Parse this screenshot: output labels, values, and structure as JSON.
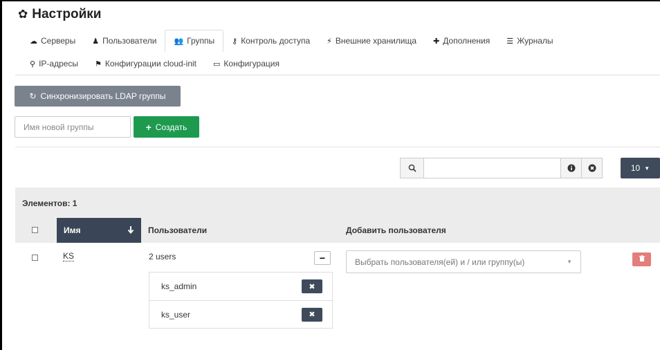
{
  "page": {
    "title": "Настройки",
    "title_icon": "gear-icon"
  },
  "tabs_row1": [
    {
      "label": "Серверы",
      "icon": "cloud-icon",
      "glyph": "☁"
    },
    {
      "label": "Пользователи",
      "icon": "user-icon",
      "glyph": "♟"
    },
    {
      "label": "Группы",
      "icon": "users-icon",
      "glyph": "👥",
      "active": true
    },
    {
      "label": "Контроль доступа",
      "icon": "key-icon",
      "glyph": "⚷"
    },
    {
      "label": "Внешние хранилища",
      "icon": "plug-icon",
      "glyph": "⚡"
    },
    {
      "label": "Дополнения",
      "icon": "puzzle-icon",
      "glyph": "✚"
    },
    {
      "label": "Журналы",
      "icon": "list-icon",
      "glyph": "☰"
    }
  ],
  "tabs_row2": [
    {
      "label": "IP-адресы",
      "icon": "map-marker-icon",
      "glyph": "⚲"
    },
    {
      "label": "Конфигурации cloud-init",
      "icon": "pushpin-icon",
      "glyph": "⚑"
    },
    {
      "label": "Конфигурация",
      "icon": "file-icon",
      "glyph": "▭"
    }
  ],
  "toolbar": {
    "sync_label": "Синхронизировать LDAP группы",
    "new_group_placeholder": "Имя новой группы",
    "create_label": "Создать"
  },
  "search": {
    "value": "",
    "page_size": "10"
  },
  "table": {
    "count_label": "Элементов: 1",
    "columns": {
      "name": "Имя",
      "users": "Пользователи",
      "add_user": "Добавить пользователя"
    },
    "rows": [
      {
        "name": "KS",
        "users_summary": "2 users",
        "members": [
          "ks_admin",
          "ks_user"
        ],
        "add_user_placeholder": "Выбрать пользователя(ей) и / или группу(ы)"
      }
    ]
  },
  "colors": {
    "create_button": "#1e9a4f",
    "sync_button": "#7a838d",
    "header_dark": "#3a4658",
    "delete_button": "#d9534f",
    "active_tab_icon": "#2e6fc1"
  }
}
